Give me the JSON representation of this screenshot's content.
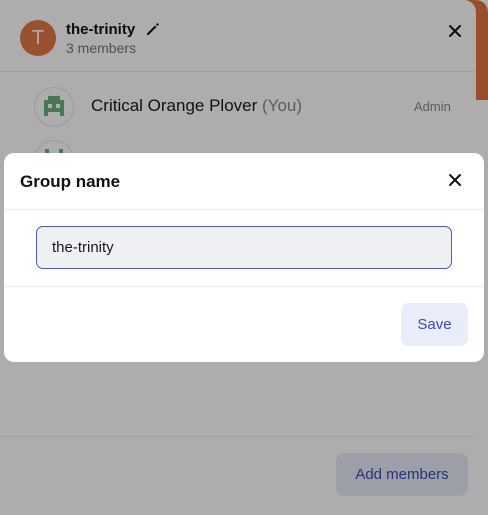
{
  "panel": {
    "avatar_initial": "T",
    "title": "the-trinity",
    "member_count": "3 members",
    "members": [
      {
        "name": "Critical Orange Plover",
        "suffix": "(You)",
        "role": "Admin"
      }
    ],
    "add_members_label": "Add members"
  },
  "modal": {
    "title": "Group name",
    "input_value": "the-trinity",
    "save_label": "Save"
  },
  "colors": {
    "accent": "#4a59c4",
    "avatar": "#e07a45",
    "button_bg": "#e9ecf9"
  }
}
